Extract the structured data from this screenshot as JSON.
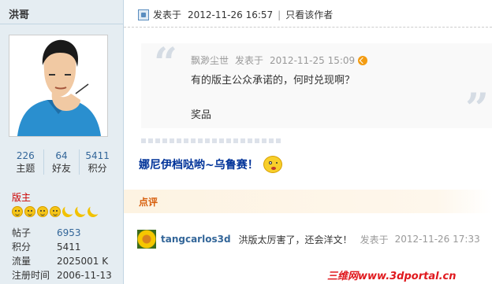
{
  "sidebar": {
    "username": "洪哥",
    "stats": [
      {
        "value": "226",
        "label": "主题"
      },
      {
        "value": "64",
        "label": "好友"
      },
      {
        "value": "5411",
        "label": "积分"
      }
    ],
    "group": "版主",
    "info": [
      {
        "key": "帖子",
        "value": "6953",
        "link": true
      },
      {
        "key": "积分",
        "value": "5411",
        "link": false
      },
      {
        "key": "流量",
        "value": "2025001 K",
        "link": false
      },
      {
        "key": "注册时间",
        "value": "2006-11-13",
        "link": false
      }
    ]
  },
  "post": {
    "posted_label": "发表于",
    "posted_time": "2012-11-26 16:57",
    "only_author": "只看该作者",
    "quote": {
      "author": "飘渺尘世",
      "posted_label": "发表于",
      "time": "2012-11-25 15:09",
      "line1": "有的版主公众承诺的，何时兑现啊？",
      "line2": "奖品"
    },
    "message": "娜尼伊档哒哟~乌鲁赛！"
  },
  "comments": {
    "header": "点评",
    "items": [
      {
        "user": "tangcarlos3d",
        "text": "洪版太厉害了，还会洋文！",
        "posted_label": "发表于",
        "time": "2012-11-26 17:33"
      }
    ]
  },
  "watermark": "三维网www.3dportal.cn"
}
